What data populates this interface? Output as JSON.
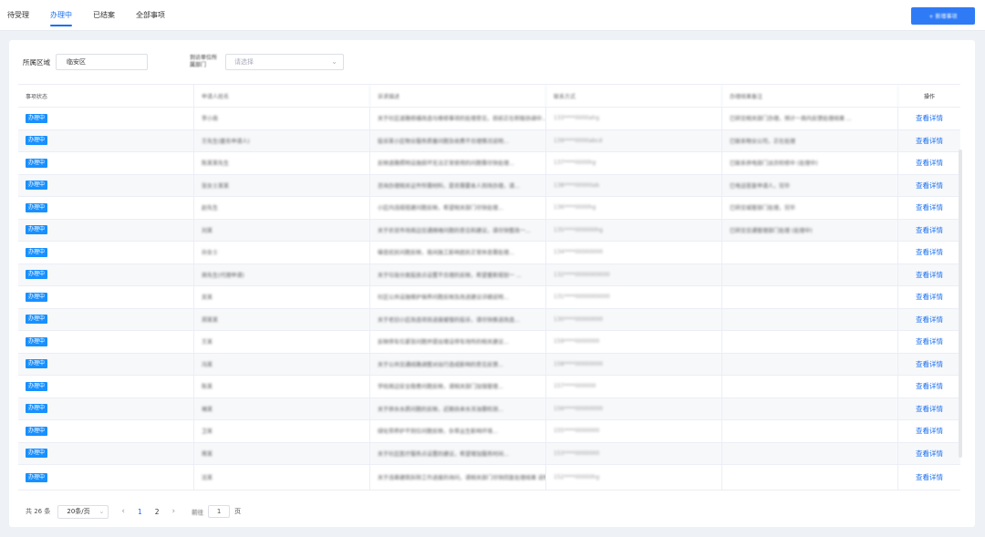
{
  "tabs": [
    "待受理",
    "办理中",
    "已结案",
    "全部事项"
  ],
  "active_tab": 1,
  "primary_button": "+ 新增事项",
  "filters": {
    "region_label": "所属区域",
    "region_value": "临安区",
    "second_label": "到访单位所属部门",
    "select_placeholder": "请选择"
  },
  "table": {
    "headers": [
      "事项状态",
      "申请人姓名",
      "诉求描述",
      "联系方式",
      "办理结果备注",
      "操作"
    ],
    "status_badge": "办理中",
    "action_link": "查看详情",
    "rows": [
      [
        "办理中",
        "李小南",
        "关于社区道路修缮改造与维修事项的处理意见，目前正在积极协调中...",
        "133****0000ahg",
        "已转交相关部门办理，预计一周内反馈处理结果 ...",
        "查看详情"
      ],
      [
        "办理中",
        "王先生(匿名申请人)",
        "投诉某小区物业服务质量问题及收费不合理情况说明...",
        "139****0000abcd",
        "已联系物业公司，正在处理",
        "查看详情"
      ],
      [
        "办理中",
        "陈某某先生",
        "反映道路照明设施损坏无法正常使用的问题需尽快处理...",
        "137****0000hg",
        "已联系供电部门派员检修中 (处理中)",
        "查看详情"
      ],
      [
        "办理中",
        "张女士某某",
        "咨询办理相关证件所需材料，是否需要本人到场办理，请...",
        "138****00000ab",
        "已电话答复申请人，完毕",
        "查看详情"
      ],
      [
        "办理中",
        "赵先生",
        "小区内违规搭建问题反映，希望相关部门尽快处理...",
        "136****0000hg",
        "已转交城管部门处理，完毕",
        "查看详情"
      ],
      [
        "办理中",
        "刘某",
        "关于农贸市场周边交通拥堵问题的意见和建议，请尽快整改一...",
        "135****000000hg",
        "已转交交通管理部门处理 (处理中)",
        "查看详情"
      ],
      [
        "办理中",
        "孙女士",
        "噪音扰民问题反映，夜间施工影响居民正常休息需处理...",
        "134****00000000",
        "",
        "查看详情"
      ],
      [
        "办理中",
        "周先生(代理申请)",
        "关于垃圾分类投放点设置不合理的反映，希望重新规划一 ...",
        "132****0000000000",
        "",
        "查看详情"
      ],
      [
        "办理中",
        "吴某",
        "社区公共设施维护保养问题反映及改进建议详细说明...",
        "131****0000000000",
        "",
        "查看详情"
      ],
      [
        "办理中",
        "郑某某",
        "关于老旧小区改造项目进度缓慢的投诉，请尽快推进改造...",
        "130****00000000",
        "",
        "查看详情"
      ],
      [
        "办理中",
        "王某",
        "反映停车位紧张问题并提出增设停车场所的相关建议...",
        "159****0000000",
        "",
        "查看详情"
      ],
      [
        "办理中",
        "冯某",
        "关于公共交通线路调整对出行造成影响的意见反馈...",
        "158****00000000",
        "",
        "查看详情"
      ],
      [
        "办理中",
        "陈某",
        "学校周边安全隐患问题反映，请相关部门加强管理...",
        "157****000000",
        "",
        "查看详情"
      ],
      [
        "办理中",
        "褚某",
        "关于供水水质问题的反映，近期自来水浑浊需检测...",
        "156****00000000",
        "",
        "查看详情"
      ],
      [
        "办理中",
        "卫某",
        "绿化带养护不到位问题反映，杂草丛生影响环境...",
        "155****0000000",
        "",
        "查看详情"
      ],
      [
        "办理中",
        "蒋某",
        "关于社区医疗服务点设置的建议，希望增加服务时间...",
        "153****0000000",
        "",
        "查看详情"
      ],
      [
        "办理中",
        "沈某",
        "关于违章建筑拆除工作进度的询问，请相关部门尽快回复处理结果 说明情况，谢谢配合",
        "152****00000hg",
        "",
        "查看详情"
      ]
    ]
  },
  "pagination": {
    "total": "共 26 条",
    "page_size": "20条/页",
    "pages": [
      "1",
      "2"
    ],
    "current_page": "1",
    "goto_label": "前往",
    "goto_value": "1",
    "page_suffix": "页"
  }
}
